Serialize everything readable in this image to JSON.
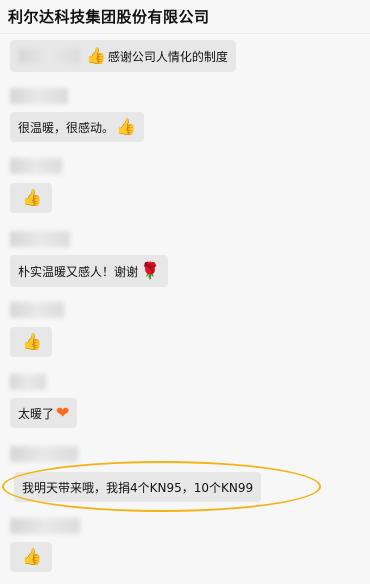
{
  "header": {
    "title": "利尔达科技集团股份有限公司"
  },
  "messages": [
    {
      "name_redacted": true,
      "text": "感谢公司人情化的制度",
      "emoji": "👍",
      "emoji_name": "thumbs-up-icon"
    },
    {
      "name_redacted": true,
      "text": "很温暖，很感动。",
      "emoji": "👍",
      "emoji_name": "thumbs-up-icon"
    },
    {
      "name_redacted": true,
      "text": "",
      "emoji": "👍",
      "emoji_name": "thumbs-up-icon"
    },
    {
      "name_redacted": true,
      "text": "朴实温暖又感人！谢谢",
      "emoji": "🌹",
      "emoji_name": "rose-icon"
    },
    {
      "name_redacted": true,
      "text": "",
      "emoji": "👍",
      "emoji_name": "thumbs-up-icon"
    },
    {
      "name_redacted": true,
      "text": "太暖了",
      "emoji": "❤",
      "emoji_name": "heart-icon"
    },
    {
      "name_redacted": true,
      "text": "我明天带来哦，我捐4个KN95，10个KN99",
      "emoji": "",
      "highlighted": true,
      "highlight_color": "#f3b315"
    },
    {
      "name_redacted": true,
      "text": "",
      "emoji": "👍",
      "emoji_name": "thumbs-up-icon"
    }
  ]
}
